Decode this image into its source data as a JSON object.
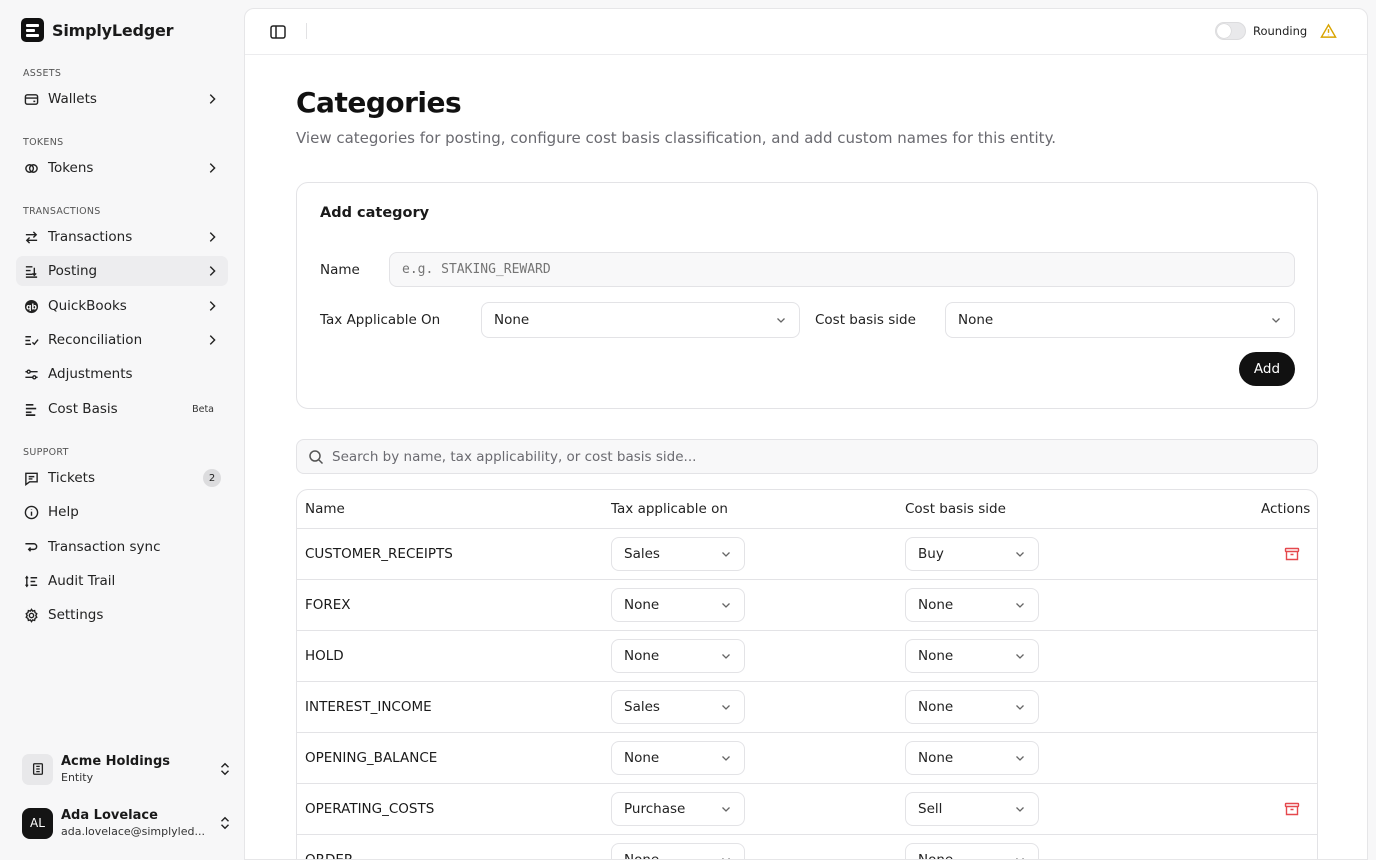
{
  "brand": {
    "name": "SimplyLedger"
  },
  "sidebar": {
    "sections": {
      "assets": "ASSETS",
      "tokens": "TOKENS",
      "transactions": "TRANSACTIONS",
      "support": "SUPPORT"
    },
    "items": {
      "wallets": "Wallets",
      "tokens": "Tokens",
      "transactions": "Transactions",
      "posting": "Posting",
      "quickbooks": "QuickBooks",
      "reconciliation": "Reconciliation",
      "adjustments": "Adjustments",
      "cost_basis": "Cost Basis",
      "cost_basis_badge": "Beta",
      "tickets": "Tickets",
      "tickets_count": "2",
      "help": "Help",
      "transaction_sync": "Transaction sync",
      "audit_trail": "Audit Trail",
      "settings": "Settings"
    },
    "entity": {
      "name": "Acme Holdings",
      "type": "Entity"
    },
    "user": {
      "initials": "AL",
      "name": "Ada Lovelace",
      "email": "ada.lovelace@simplyled..."
    }
  },
  "topbar": {
    "rounding_label": "Rounding"
  },
  "page": {
    "title": "Categories",
    "subtitle": "View categories for posting, configure cost basis classification, and add custom names for this entity."
  },
  "add_form": {
    "title": "Add category",
    "name_label": "Name",
    "name_placeholder": "e.g. STAKING_REWARD",
    "tax_label": "Tax Applicable On",
    "tax_value": "None",
    "cost_basis_label": "Cost basis side",
    "cost_basis_value": "None",
    "add_label": "Add"
  },
  "search": {
    "placeholder": "Search by name, tax applicability, or cost basis side..."
  },
  "table": {
    "headers": {
      "name": "Name",
      "tax": "Tax applicable on",
      "cost_basis": "Cost basis side",
      "actions": "Actions"
    },
    "rows": [
      {
        "name": "CUSTOMER_RECEIPTS",
        "tax": "Sales",
        "cost_basis": "Buy"
      },
      {
        "name": "FOREX",
        "tax": "None",
        "cost_basis": "None"
      },
      {
        "name": "HOLD",
        "tax": "None",
        "cost_basis": "None"
      },
      {
        "name": "INTEREST_INCOME",
        "tax": "Sales",
        "cost_basis": "None"
      },
      {
        "name": "OPENING_BALANCE",
        "tax": "None",
        "cost_basis": "None"
      },
      {
        "name": "OPERATING_COSTS",
        "tax": "Purchase",
        "cost_basis": "Sell"
      },
      {
        "name": "ORDER",
        "tax": "None",
        "cost_basis": "None"
      }
    ]
  },
  "colors": {
    "accent": "#111111",
    "danger": "#e5484d",
    "active_nav": "#ededef"
  }
}
